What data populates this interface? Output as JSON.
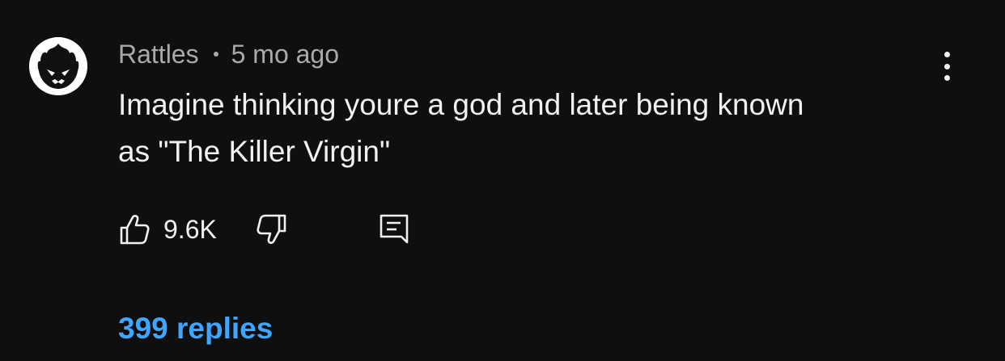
{
  "comment": {
    "author": "Rattles",
    "timestamp": "5 mo ago",
    "text": "Imagine thinking youre a god and later being known\nas \"The Killer Virgin\"",
    "like_count": "9.6K",
    "replies_label": "399 replies"
  },
  "icons": {
    "avatar": "flame-skull-avatar",
    "more": "more-vertical-icon",
    "like": "thumbs-up-icon",
    "dislike": "thumbs-down-icon",
    "reply": "reply-comment-icon"
  },
  "colors": {
    "background": "#0f0f0f",
    "primary_text": "#f1f1f1",
    "secondary_text": "#aaaaaa",
    "link": "#3ea6ff"
  }
}
